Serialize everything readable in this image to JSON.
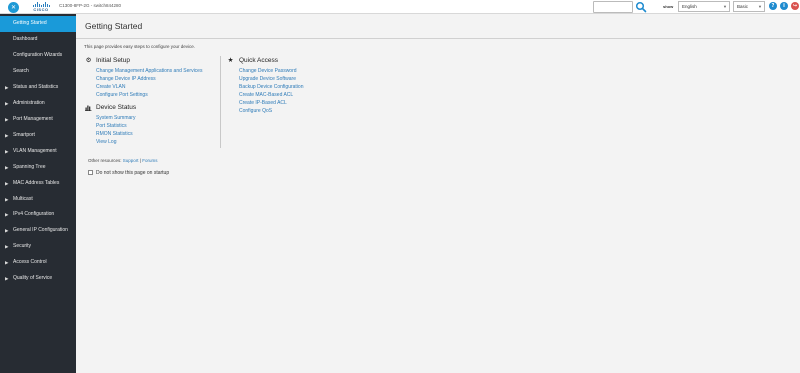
{
  "header": {
    "logo_badge": "✕",
    "brand": "CISCO",
    "device_title": "C1300-8FP-2G - switch844280",
    "search_value": "",
    "show_label": "show",
    "language": "English",
    "mode": "Basic",
    "help_icon": "?",
    "info_icon": "i",
    "exit_icon": "↪",
    "accent_color": "#1a9ad9"
  },
  "sidebar": {
    "items": [
      {
        "label": "Getting Started",
        "expandable": false,
        "active": true
      },
      {
        "label": "Dashboard",
        "expandable": false,
        "active": false
      },
      {
        "label": "Configuration Wizards",
        "expandable": false,
        "active": false
      },
      {
        "label": "Search",
        "expandable": false,
        "active": false
      },
      {
        "label": "Status and Statistics",
        "expandable": true,
        "active": false
      },
      {
        "label": "Administration",
        "expandable": true,
        "active": false
      },
      {
        "label": "Port Management",
        "expandable": true,
        "active": false
      },
      {
        "label": "Smartport",
        "expandable": true,
        "active": false
      },
      {
        "label": "VLAN Management",
        "expandable": true,
        "active": false
      },
      {
        "label": "Spanning Tree",
        "expandable": true,
        "active": false
      },
      {
        "label": "MAC Address Tables",
        "expandable": true,
        "active": false
      },
      {
        "label": "Multicast",
        "expandable": true,
        "active": false
      },
      {
        "label": "IPv4 Configuration",
        "expandable": true,
        "active": false
      },
      {
        "label": "General IP Configuration",
        "expandable": true,
        "active": false
      },
      {
        "label": "Security",
        "expandable": true,
        "active": false
      },
      {
        "label": "Access Control",
        "expandable": true,
        "active": false
      },
      {
        "label": "Quality of Service",
        "expandable": true,
        "active": false
      }
    ]
  },
  "main": {
    "title": "Getting Started",
    "intro": "This page provides easy steps to configure your device.",
    "initial_setup": {
      "title": "Initial Setup",
      "icon": "gear-icon",
      "links": [
        "Change Management Applications and Services",
        "Change Device IP Address",
        "Create VLAN",
        "Configure Port Settings"
      ]
    },
    "device_status": {
      "title": "Device Status",
      "icon": "bar-chart-icon",
      "links": [
        "System Summary",
        "Port Statistics",
        "RMON Statistics",
        "View Log"
      ]
    },
    "quick_access": {
      "title": "Quick Access",
      "icon": "star-icon",
      "links": [
        "Change Device Password",
        "Upgrade Device Software",
        "Backup Device Configuration",
        "Create MAC-Based ACL",
        "Create IP-Based ACL",
        "Configure QoS"
      ]
    },
    "resources": {
      "label": "Other resources:",
      "support": "Support",
      "separator": "|",
      "forums": "Forums"
    },
    "startup_checkbox": {
      "label": "Do not show this page on startup",
      "checked": false
    }
  }
}
